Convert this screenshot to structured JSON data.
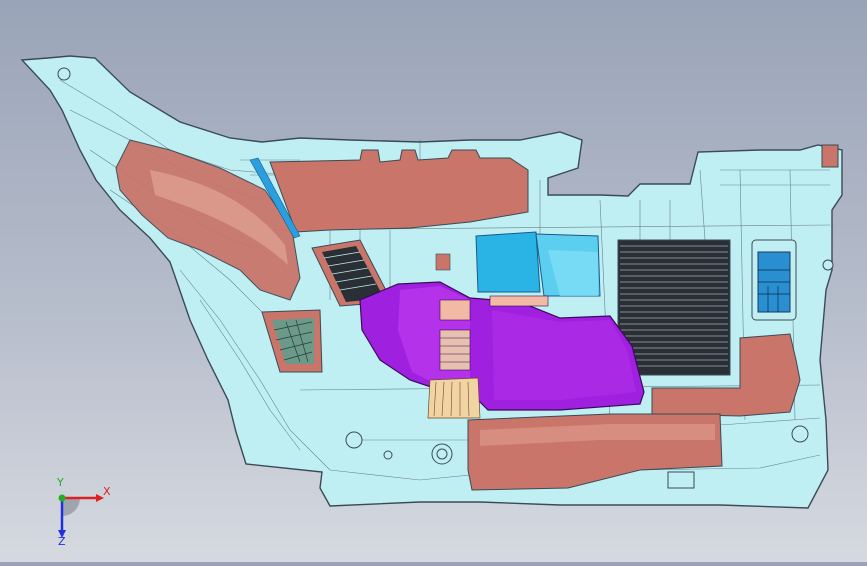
{
  "viewport": {
    "background_top": "#9aa4b8",
    "background_bottom": "#d6d9e0"
  },
  "part": {
    "body_color": "#bfeff2",
    "edge_color": "#3b4a56",
    "panel_color": "#c9756a",
    "module_color": "#a020e0",
    "duct_color": "#2ab4e6",
    "grille_color": "#2a2f36"
  },
  "triad": {
    "x_label": "X",
    "y_label": "Y",
    "z_label": "Z",
    "x_color": "#e02020",
    "y_color": "#20b020",
    "z_color": "#2030e0"
  }
}
